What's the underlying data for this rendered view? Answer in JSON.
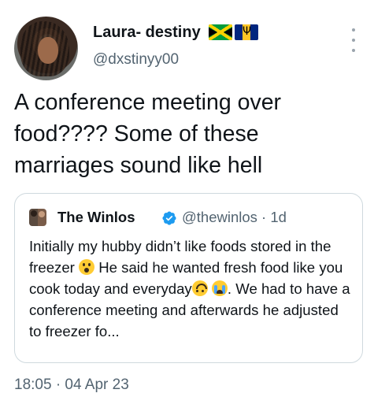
{
  "author": {
    "display_name": "Laura- destiny",
    "flags": [
      "jamaica-flag",
      "barbados-flag"
    ],
    "handle": "@dxstinyy00"
  },
  "tweet": {
    "text": "A conference meeting over food???? Some of these marriages sound like hell",
    "timestamp": "18:05 · 04 Apr 23"
  },
  "quoted_tweet": {
    "author_name": "The Winlos",
    "verified": true,
    "handle_and_time": "@thewinlos · 1d",
    "text_part1": "Initially my hubby didn’t like foods stored in the freezer ",
    "text_part2": " He said he wanted fresh food like you cook today and everyday",
    "text_part3": ". We had to have a conference meeting and afterwards he adjusted to freezer fo...",
    "emojis": [
      "surprised-face",
      "upside-down-face",
      "crying-face"
    ]
  },
  "colors": {
    "text_primary": "#0f1419",
    "text_secondary": "#536471",
    "verified_blue": "#1d9bf0",
    "border": "#cfd9de"
  }
}
